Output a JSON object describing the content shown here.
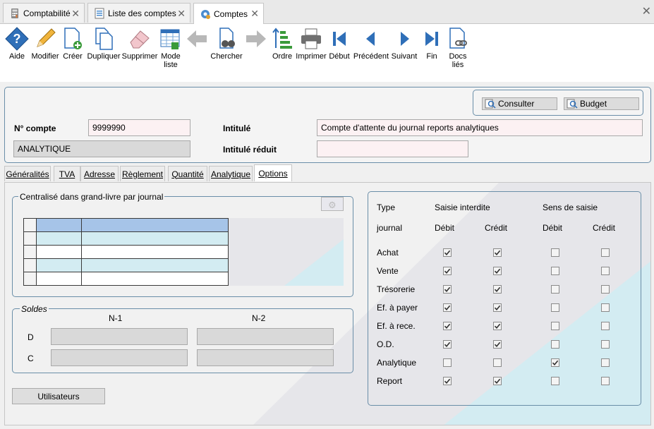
{
  "doc_tabs": [
    {
      "label": "Comptabilité"
    },
    {
      "label": "Liste des comptes"
    },
    {
      "label": "Comptes"
    }
  ],
  "toolbar": {
    "aide": "Aide",
    "modifier": "Modifier",
    "creer": "Créer",
    "dupliquer": "Dupliquer",
    "supprimer": "Supprimer",
    "mode_liste_1": "Mode",
    "mode_liste_2": "liste",
    "chercher": "Chercher",
    "ordre": "Ordre",
    "imprimer": "Imprimer",
    "debut": "Début",
    "precedent": "Précédent",
    "suivant": "Suivant",
    "fin": "Fin",
    "docs_lies_1": "Docs",
    "docs_lies_2": "liés"
  },
  "header": {
    "consulter": "Consulter",
    "budget": "Budget",
    "no_compte_label": "N° compte",
    "no_compte_value": "9999990",
    "type_value": "ANALYTIQUE",
    "intitule_label": "Intitulé",
    "intitule_value": "Compte d'attente du journal reports analytiques",
    "intitule_reduit_label": "Intitulé réduit",
    "intitule_reduit_value": ""
  },
  "form_tabs": [
    "Généralités",
    "TVA",
    "Adresse",
    "Règlement",
    "Quantité",
    "Analytique",
    "Options"
  ],
  "centralise": {
    "title": "Centralisé dans grand-livre par journal"
  },
  "soldes": {
    "title": "Soldes",
    "n1": "N-1",
    "n2": "N-2",
    "d": "D",
    "c": "C"
  },
  "utilisateurs_button": "Utilisateurs",
  "journal_table": {
    "header_type": "Type",
    "header_journal": "journal",
    "header_saisie": "Saisie interdite",
    "header_sens": "Sens de saisie",
    "debit1": "Débit",
    "credit1": "Crédit",
    "debit2": "Débit",
    "credit2": "Crédit",
    "rows": [
      {
        "label": "Achat",
        "saisie_debit": true,
        "saisie_credit": true,
        "sens_debit": false,
        "sens_credit": false
      },
      {
        "label": "Vente",
        "saisie_debit": true,
        "saisie_credit": true,
        "sens_debit": false,
        "sens_credit": false
      },
      {
        "label": "Trésorerie",
        "saisie_debit": true,
        "saisie_credit": true,
        "sens_debit": false,
        "sens_credit": false
      },
      {
        "label": "Ef. à payer",
        "saisie_debit": true,
        "saisie_credit": true,
        "sens_debit": false,
        "sens_credit": false
      },
      {
        "label": "Ef.  à rece.",
        "saisie_debit": true,
        "saisie_credit": true,
        "sens_debit": false,
        "sens_credit": false
      },
      {
        "label": "O.D.",
        "saisie_debit": true,
        "saisie_credit": true,
        "sens_debit": false,
        "sens_credit": false
      },
      {
        "label": "Analytique",
        "saisie_debit": false,
        "saisie_credit": false,
        "sens_debit": true,
        "sens_credit": false
      },
      {
        "label": "Report",
        "saisie_debit": true,
        "saisie_credit": true,
        "sens_debit": false,
        "sens_credit": false
      }
    ]
  }
}
